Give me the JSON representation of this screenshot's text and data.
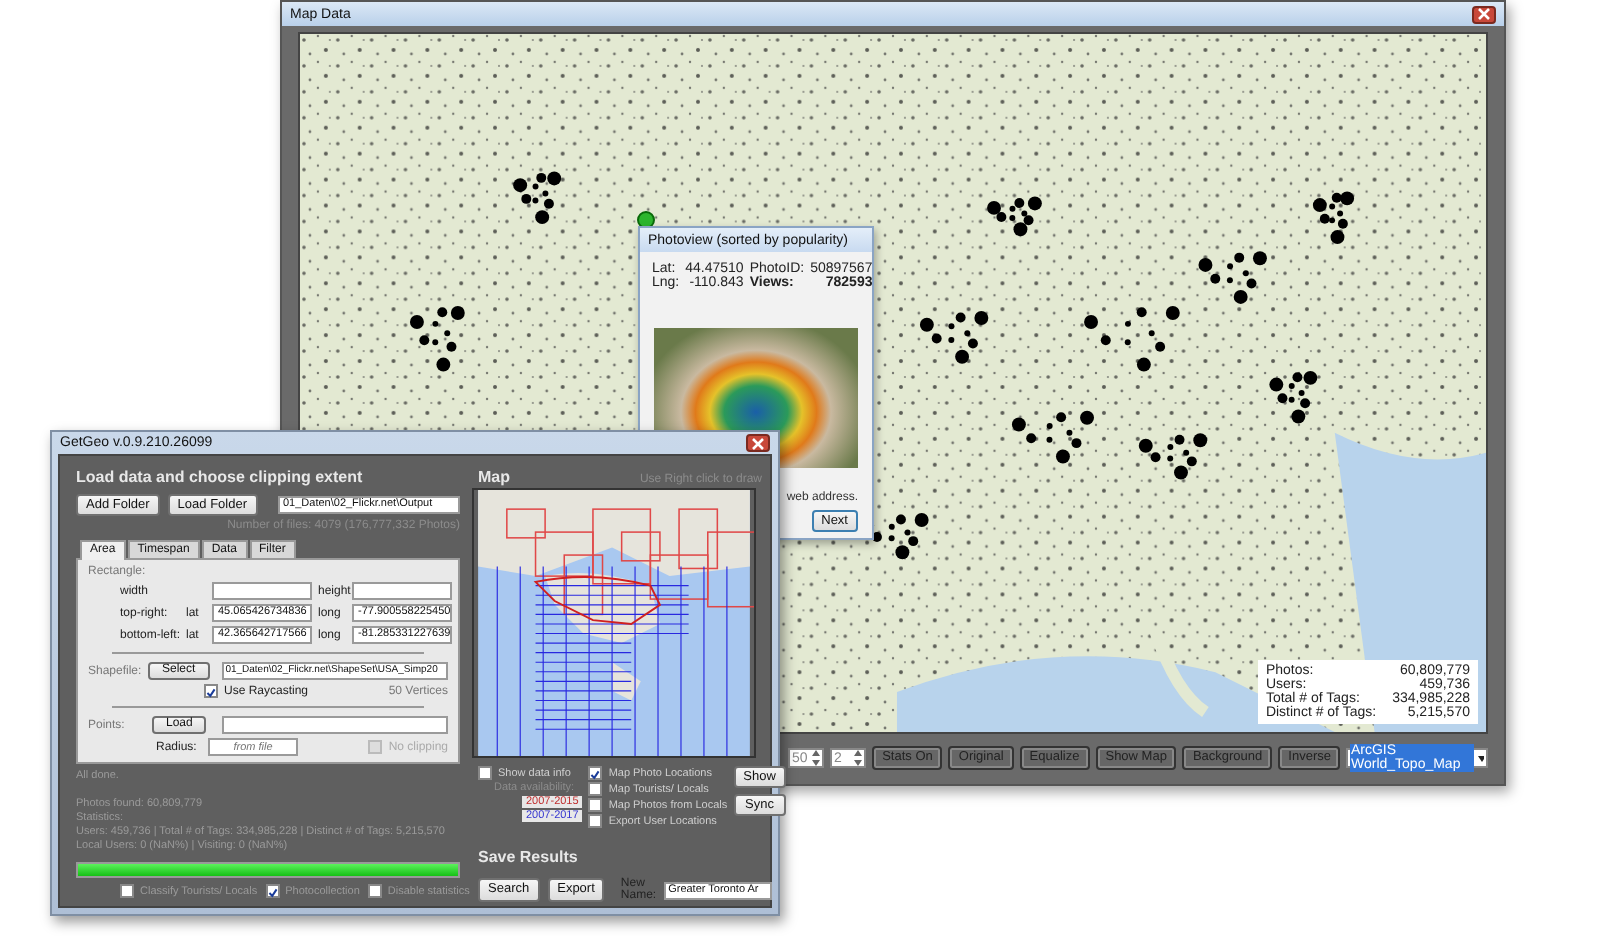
{
  "map_window": {
    "title": "Map Data",
    "stats": [
      {
        "label": "Photos:",
        "value": "60,809,779"
      },
      {
        "label": "Users:",
        "value": "459,736"
      },
      {
        "label": "Total # of Tags:",
        "value": "334,985,228"
      },
      {
        "label": "Distinct # of Tags:",
        "value": "5,215,570"
      }
    ],
    "toolbar": {
      "spinners": [
        "50",
        "2"
      ],
      "buttons": [
        "Stats On",
        "Original",
        "Equalize",
        "Show Map",
        "Background",
        "Inverse"
      ],
      "basemap": {
        "value": "ArcGIS World_Topo_Map",
        "highlighted": true
      }
    }
  },
  "photoview": {
    "title": "Photoview (sorted by popularity)",
    "fields": [
      {
        "label": "Lat:",
        "value": "44.47510",
        "strong": false
      },
      {
        "label": "PhotoID:",
        "value": "50897567",
        "strong": false
      },
      {
        "label": "Lng:",
        "value": "-110.843",
        "strong": false
      },
      {
        "label": "Views:",
        "value": "782593",
        "strong": true
      }
    ],
    "note": "web address.",
    "next_button": "Next"
  },
  "getgeo": {
    "title": "GetGeo v.0.9.210.26099",
    "heading": "Load data and choose clipping extent",
    "folder_buttons": [
      "Add Folder",
      "Load Folder"
    ],
    "folder_path": "01_Daten\\02_Flickr.net\\Output",
    "file_count": "Number of files: 4079 (176,777,332 Photos)",
    "tabs": [
      {
        "label": "Area",
        "selected": true
      },
      {
        "label": "Timespan",
        "selected": false
      },
      {
        "label": "Data",
        "selected": false
      },
      {
        "label": "Filter",
        "selected": false
      }
    ],
    "rectangle": {
      "label": "Rectangle:",
      "width_label": "width",
      "height_label": "height",
      "rows": [
        {
          "label": "top-right:",
          "lat_label": "lat",
          "lat": "45.065426734836",
          "long_label": "long",
          "long": "-77.900558225450"
        },
        {
          "label": "bottom-left:",
          "lat_label": "lat",
          "lat": "42.365642717566",
          "long_label": "long",
          "long": "-81.285331227639"
        }
      ]
    },
    "shapefile": {
      "label": "Shapefile:",
      "button": "Select",
      "path": "01_Daten\\02_Flickr.net\\ShapeSet\\USA_Simp20",
      "raycasting": {
        "label": "Use Raycasting",
        "checked": true
      },
      "vertices": "50 Vertices"
    },
    "points": {
      "label": "Points:",
      "button": "Load",
      "radius_label": "Radius:",
      "radius_placeholder": "from file",
      "no_clipping": {
        "label": "No clipping",
        "checked": false,
        "disabled": true
      }
    },
    "status": [
      "All done.",
      "Photos found: 60,809,779",
      "Statistics:",
      "Users: 459,736 | Total # of Tags: 334,985,228 | Distinct # of Tags: 5,215,570",
      "Local Users: 0 (NaN%) | Visiting: 0 (NaN%)"
    ],
    "progress": {
      "level": 1
    },
    "options": [
      {
        "label": "Classify Tourists/ Locals",
        "checked": false
      },
      {
        "label": "Photocollection",
        "checked": true
      },
      {
        "label": "Disable statistics",
        "checked": false
      }
    ],
    "map": {
      "heading": "Map",
      "hint": "Use Right click to draw",
      "show_data_info": {
        "label": "Show data info",
        "checked": false
      },
      "availability_label": "Data availability:",
      "availability": [
        {
          "label": "2007-2015",
          "color": "#c03030"
        },
        {
          "label": "2007-2017",
          "color": "#3838d0"
        }
      ],
      "layers": [
        {
          "label": "Map Photo Locations",
          "checked": true
        },
        {
          "label": "Map Tourists/ Locals",
          "checked": false
        },
        {
          "label": "Map Photos from Locals",
          "checked": false
        },
        {
          "label": "Export User Locations",
          "checked": false
        }
      ],
      "buttons": [
        "Show",
        "Sync"
      ]
    },
    "save": {
      "heading": "Save Results",
      "buttons": [
        "Search",
        "Export"
      ],
      "name_label": "New Name:",
      "name_value": "Greater Toronto Ar"
    }
  }
}
